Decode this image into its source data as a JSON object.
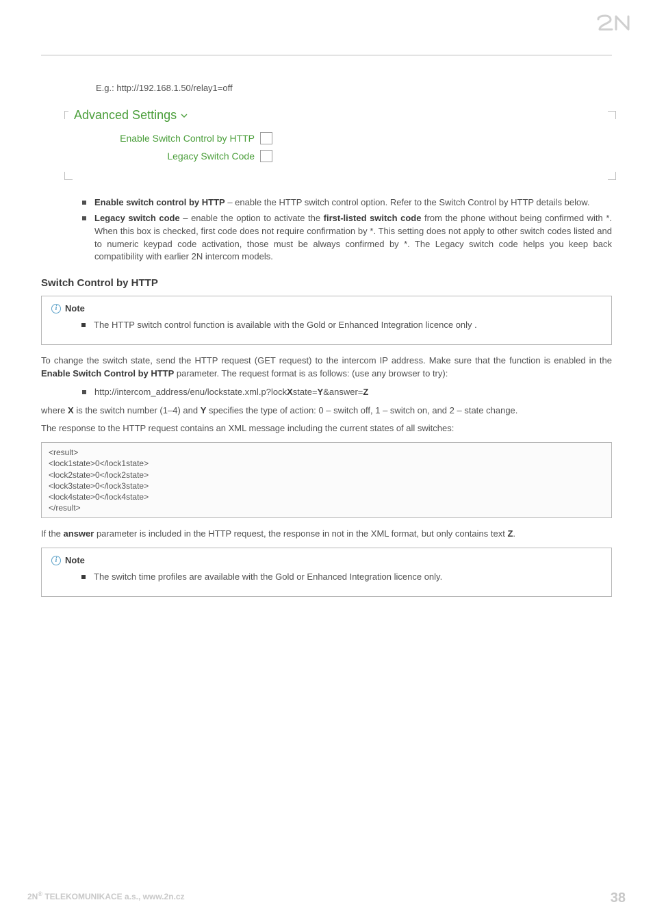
{
  "logo_text": "2N",
  "example_line": "E.g.: http://192.168.1.50/relay1=off",
  "settings_panel": {
    "title": "Advanced Settings",
    "rows": [
      {
        "label": "Enable Switch Control by HTTP",
        "checked": false
      },
      {
        "label": "Legacy Switch Code",
        "checked": false
      }
    ]
  },
  "bullets_main": [
    {
      "lead": "Enable switch control by HTTP",
      "rest": " – enable the HTTP switch control option. Refer to the Switch Control by HTTP details below."
    },
    {
      "lead": "Legacy switch code",
      "rest": " – enable the option to activate the ",
      "mid_bold": "first-listed switch code",
      "rest2": " from the phone without being confirmed with *. When this box is checked, first code does not require confirmation by *. This setting does not apply to other switch codes listed and to numeric keypad code activation, those must be always confirmed by *. The Legacy switch code helps you keep back compatibility with earlier 2N intercom models."
    }
  ],
  "section_heading": "Switch Control by HTTP",
  "note1": {
    "title": "Note",
    "text": "The HTTP switch control function is available with the Gold or Enhanced Integration licence only ."
  },
  "para1_a": "To change the switch state, send the HTTP request (GET request) to the intercom IP address. Make sure that the function is enabled in the ",
  "para1_bold": "Enable Switch Control by HTTP",
  "para1_b": " parameter. The request format is as follows: (use any browser to try):",
  "url_line": {
    "p1": "http://intercom_address/enu/lockstate.xml.p?lock",
    "X": "X",
    "p2": "state=",
    "Y": "Y",
    "p3": "&answer=",
    "Z": "Z"
  },
  "para2": {
    "a": "where ",
    "X": "X",
    "b": " is the switch number (1–4) and ",
    "Y": "Y",
    "c": " specifies the type of action: 0 – switch off, 1 – switch on, and 2 – state change."
  },
  "para3": "The response to the HTTP request contains an XML message including the current states of all switches:",
  "code_lines": [
    "<result>",
    " <lock1state>0</lock1state>",
    " <lock2state>0</lock2state>",
    " <lock3state>0</lock3state>",
    " <lock4state>0</lock4state>",
    "</result>"
  ],
  "para4": {
    "a": " If the ",
    "bold": "answer",
    "b": " parameter is included in the HTTP request, the response in not in the XML format, but only contains text ",
    "Z": "Z",
    "c": "."
  },
  "note2": {
    "title": "Note",
    "text": "The switch time profiles are available with the Gold or Enhanced Integration licence only."
  },
  "footer": {
    "left_a": "2N",
    "left_sup": "®",
    "left_b": " TELEKOMUNIKACE a.s., www.2n.cz",
    "page": "38"
  }
}
